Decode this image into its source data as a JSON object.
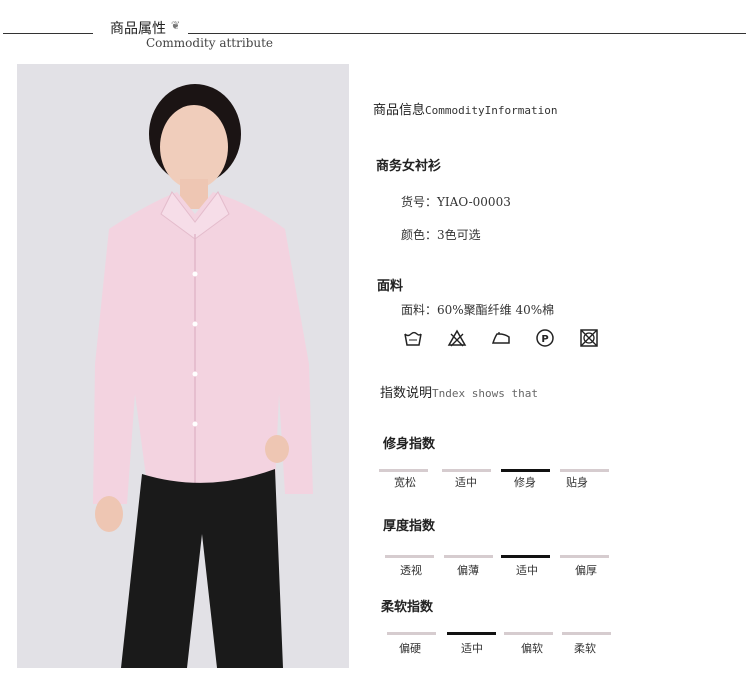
{
  "header": {
    "title_cn": "商品属性",
    "title_en": "Commodity attribute",
    "leaf_glyph": "❦"
  },
  "info": {
    "title_cn": "商品信息",
    "title_en": "CommodityInformation",
    "product_name": "商务女衬衫",
    "sku_line": "货号：YIAO-00003",
    "color_line": "颜色：3色可选"
  },
  "fabric": {
    "title": "面料",
    "composition": "面料：60%聚酯纤维 40%棉",
    "care_icons": [
      "wash-icon",
      "no-bleach-icon",
      "iron-icon",
      "dry-clean-p-icon",
      "no-tumble-dry-icon"
    ]
  },
  "index_note": {
    "cn": "指数说明",
    "en": "Tndex shows that"
  },
  "fit": {
    "title": "修身指数",
    "options": [
      "宽松",
      "适中",
      "修身",
      "贴身"
    ],
    "selected_index": 2
  },
  "thickness": {
    "title": "厚度指数",
    "options": [
      "透视",
      "偏薄",
      "适中",
      "偏厚"
    ],
    "selected_index": 2
  },
  "softness": {
    "title": "柔软指数",
    "options": [
      "偏硬",
      "适中",
      "偏软",
      "柔软"
    ],
    "selected_index": 1
  },
  "colors": {
    "selected_bar": "#111111",
    "bar": "#d6cccf",
    "shirt": "#f3d3e0",
    "pants": "#1a1a1a",
    "photo_bg": "#e2e1e6"
  }
}
